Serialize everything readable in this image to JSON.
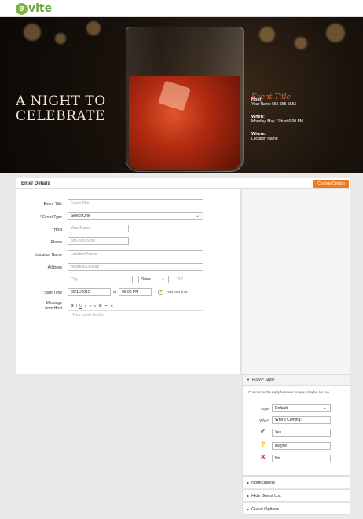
{
  "brand": {
    "logo_mark": "e",
    "logo_text": "vite"
  },
  "hero": {
    "title_line1": "A NIGHT TO",
    "title_line2": "CELEBRATE",
    "event_title": "Event Title",
    "host_label": "Host:",
    "host_value": "Your Name  555-555-5555",
    "when_label": "When:",
    "when_value": "Monday, May 11th at 6:00 PM",
    "where_label": "Where:",
    "where_value": "Location Name"
  },
  "details": {
    "label": "Enter Details",
    "change_design": "Change Design"
  },
  "form": {
    "event_title_label": "Event Title",
    "event_title_placeholder": "Event Title",
    "event_type_label": "Event Type",
    "event_type_value": "Select One",
    "host_label": "Host",
    "host_placeholder": "Your Name",
    "phone_label": "Phone",
    "phone_placeholder": "555-555-5555",
    "location_label": "Location Name",
    "location_placeholder": "Location Name",
    "address_label": "Address",
    "address_placeholder": "Address Lookup",
    "city_placeholder": "City",
    "state_value": "State",
    "zip_placeholder": "ZIP",
    "start_time_label": "Start Time",
    "start_date_value": "05/11/2015",
    "at_label": "at",
    "start_time_value": "06:00 PM",
    "add_end_time": "Add end time",
    "message_label_line1": "Message",
    "message_label_line2": "from Host",
    "message_placeholder": "Your event details...",
    "toolbar": {
      "bold": "B",
      "italic": "I",
      "underline": "U",
      "align_left": "≡",
      "align_center": "≡",
      "align_right": "≡",
      "list": "☰",
      "link": "⚭",
      "clear": "✕"
    }
  },
  "rsvp": {
    "heading": "RSVP Style",
    "description": "Customize the reply headers for yes, maybe and no.",
    "style_label": "Style",
    "style_value": "Default",
    "who_label": "Who?",
    "who_value": "Who's Coming?",
    "yes_value": "Yes",
    "maybe_value": "Maybe",
    "no_value": "No"
  },
  "sections": {
    "notifications": "Notifications",
    "hide_guest_list": "Hide Guest List",
    "guest_options": "Guest Options"
  },
  "colors": {
    "brand_green": "#7cb342",
    "accent_orange": "#f27a1a",
    "yes_green": "#4caf50",
    "maybe_yellow": "#f2b01a",
    "no_red": "#d33"
  }
}
